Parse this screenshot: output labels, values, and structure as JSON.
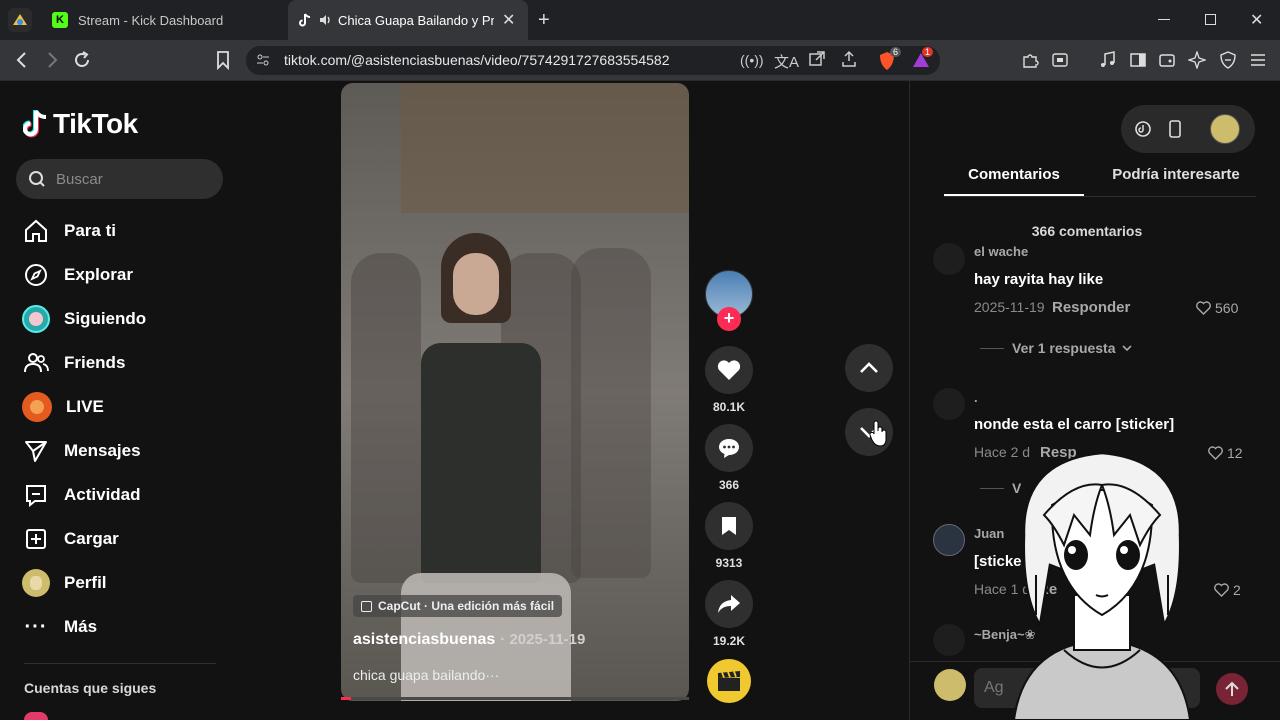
{
  "browser": {
    "tabs": [
      {
        "title": "Stream - Kick Dashboard"
      },
      {
        "title": "Chica Guapa Bailando y Prueb"
      }
    ],
    "url": "tiktok.com/@asistenciasbuenas/video/7574291727683554582",
    "shield_badge": "6",
    "alert_badge": "1"
  },
  "sidebar": {
    "logo": "TikTok",
    "search_placeholder": "Buscar",
    "items": [
      {
        "label": "Para ti",
        "icon": "home-icon"
      },
      {
        "label": "Explorar",
        "icon": "compass-icon"
      },
      {
        "label": "Siguiendo",
        "icon": "following-avatar-icon"
      },
      {
        "label": "Friends",
        "icon": "friends-icon"
      },
      {
        "label": "LIVE",
        "icon": "live-avatar-icon"
      },
      {
        "label": "Mensajes",
        "icon": "send-icon"
      },
      {
        "label": "Actividad",
        "icon": "activity-icon"
      },
      {
        "label": "Cargar",
        "icon": "upload-icon"
      },
      {
        "label": "Perfil",
        "icon": "profile-avatar-icon"
      },
      {
        "label": "Más",
        "icon": "more-icon"
      }
    ],
    "following_title": "Cuentas que sigues"
  },
  "video": {
    "capcut_label": "CapCut · Una edición más fácil",
    "author": "asistenciasbuenas",
    "date": "· 2025-11-19",
    "caption": "chica guapa bailando···",
    "likes": "80.1K",
    "comments": "366",
    "saves": "9313",
    "shares": "19.2K"
  },
  "panel": {
    "tab_comments": "Comentarios",
    "tab_related": "Podría interesarte",
    "comment_count": "366 comentarios",
    "comments": [
      {
        "user": "el wache",
        "text": "hay rayita hay like",
        "date": "2025-11-19",
        "reply": "Responder",
        "likes": "560",
        "view_replies": "Ver 1 respuesta"
      },
      {
        "user": ".",
        "text": "nonde esta el carro [sticker]",
        "date": "Hace 2 d",
        "reply": "Resp",
        "likes": "12",
        "view_replies": "V"
      },
      {
        "user": "Juan",
        "text": "[sticke",
        "date": "Hace 1 d",
        "reply": "Re",
        "likes": "2"
      },
      {
        "user": "~Benja~❀"
      }
    ],
    "input_placeholder": "Ag"
  }
}
